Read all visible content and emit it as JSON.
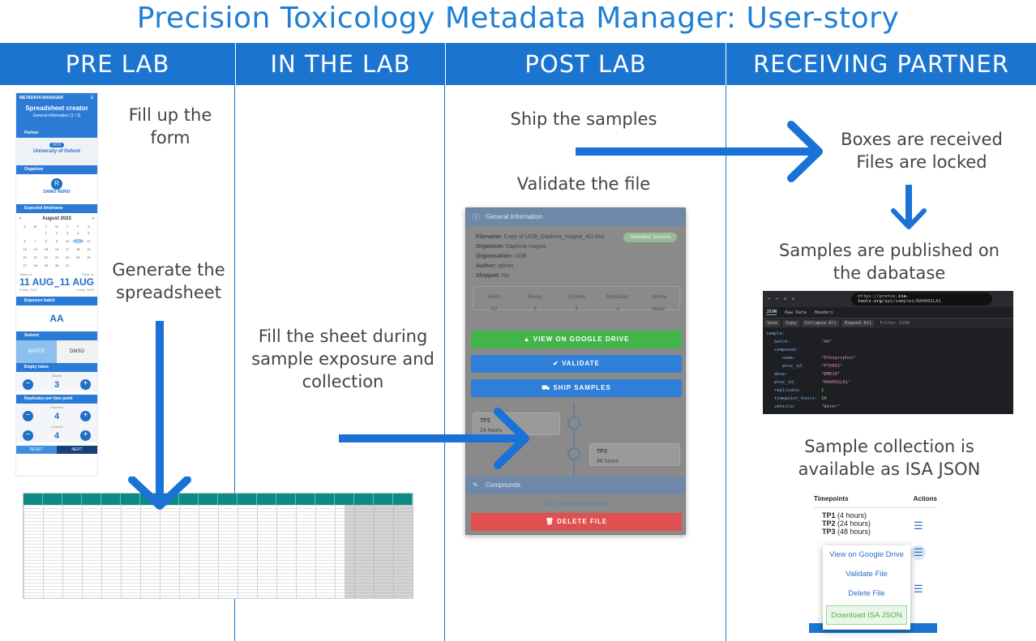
{
  "title": "Precision Toxicology Metadata Manager: User-story",
  "columns": [
    "PRE LAB",
    "IN THE LAB",
    "POST LAB",
    "RECEIVING PARTNER"
  ],
  "steps": {
    "fill_form": "Fill up the\nform",
    "generate": "Generate the\nspreadsheet",
    "fill_sheet": "Fill the sheet during\nsample exposure and\ncollection",
    "ship": "Ship the samples",
    "validate": "Validate the file",
    "received": "Boxes are received\nFiles are locked",
    "published": "Samples are published on\nthe dabatase",
    "isa": "Sample collection is\navailable as ISA JSON"
  },
  "phone": {
    "brand": "METADATA MANAGER",
    "heading": "Spreadsheet creator",
    "subheading": "General Information (1 / 3)",
    "partner_label": "Partner",
    "partner_code": "UOX",
    "partner_name": "University of Oxford",
    "organism_label": "Organism",
    "organism_code": "R",
    "organism_name": "DANIO RERIO",
    "timeframe_label": "Expected timeframe",
    "month": "August 2023",
    "weekdays": [
      "S",
      "M",
      "T",
      "W",
      "T",
      "F",
      "S"
    ],
    "days": [
      "",
      "",
      "1",
      "2",
      "3",
      "4",
      "5",
      "6",
      "7",
      "8",
      "9",
      "10",
      "11",
      "12",
      "13",
      "14",
      "15",
      "16",
      "17",
      "18",
      "19",
      "20",
      "21",
      "22",
      "23",
      "24",
      "25",
      "26",
      "27",
      "28",
      "29",
      "30",
      "31",
      "",
      ""
    ],
    "start_label": "Starts on",
    "start_date": "11 AUG",
    "start_day": "Friday, 2023",
    "end_label": "Ends on",
    "end_date": "11 AUG",
    "end_day": "Friday, 2023",
    "exposure_label": "Exposure batch",
    "exposure_value": "AA",
    "solvent_label": "Solvent",
    "solvent_opt1": "WATER",
    "solvent_opt2": "DMSO",
    "empty_label": "Empty tubes",
    "blanks_label": "Blanks",
    "blanks_value": "3",
    "replicates_label": "Replicates per time point",
    "exposed_label": "Exposed",
    "exposed_value": "4",
    "controls_label": "Controls",
    "controls_value": "4",
    "reset": "RESET",
    "next": "NEXT"
  },
  "validator": {
    "section1": "General Information",
    "filename_label": "Filename:",
    "filename": "Copy of UOB_Daphnia_magna_AD.xlsx",
    "organism_label": "Organism:",
    "organism": "Daphnia magna",
    "organisation_label": "Organisation:",
    "organisation": "UOB",
    "author_label": "Author:",
    "author": "admin",
    "shipped_label": "Shipped:",
    "shipped": "No",
    "badge": "Validated: success",
    "table_headers": [
      "Batch",
      "Blanks",
      "Controls",
      "Replicates",
      "Vehicle"
    ],
    "table_values": [
      "AD",
      "3",
      "4",
      "4",
      "Water"
    ],
    "btn_drive": "VIEW ON GOOGLE DRIVE",
    "btn_validate": "VALIDATE",
    "btn_ship": "SHIP SAMPLES",
    "tp2": "TP2",
    "tp2_hours": "24 hours",
    "tp3": "TP3",
    "tp3_hours": "48 hours",
    "section2": "Compounds",
    "compound": "N,N'-diethylacrylamide",
    "btn_delete": "DELETE FILE"
  },
  "json_viewer": {
    "url_prefix": "https://pretox.",
    "url_domain": "isa-tools.org",
    "url_path": "/api/samples/RAA002LA1",
    "tabs": [
      "JSON",
      "Raw Data",
      "Headers"
    ],
    "tools": [
      "Save",
      "Copy",
      "Collapse All",
      "Expand All",
      "Filter JSON"
    ],
    "lines": [
      {
        "key": "sample:",
        "val": "",
        "indent": 0
      },
      {
        "key": "batch:",
        "val": "\"AA\"",
        "indent": 1
      },
      {
        "key": "compound:",
        "val": "",
        "indent": 1
      },
      {
        "key": "name:",
        "val": "\"Ethoprophos\"",
        "indent": 2
      },
      {
        "key": "ptox_id:",
        "val": "\"PTX002\"",
        "indent": 2
      },
      {
        "key": "dose:",
        "val": "\"BMD10\"",
        "indent": 1
      },
      {
        "key": "ptox_id:",
        "val": "\"RAA002LA1\"",
        "indent": 1
      },
      {
        "key": "replicate:",
        "val": "1",
        "indent": 1
      },
      {
        "key": "timepoint_hours:",
        "val": "10",
        "indent": 1
      },
      {
        "key": "vehicle:",
        "val": "\"Water\"",
        "indent": 1
      }
    ]
  },
  "timepoints": {
    "header": "Timepoints",
    "actions": "Actions",
    "items": [
      {
        "tp": "TP1",
        "hours": "(4 hours)"
      },
      {
        "tp": "TP2",
        "hours": "(24 hours)"
      },
      {
        "tp": "TP3",
        "hours": "(48 hours)"
      }
    ],
    "menu": [
      "View on Google Drive",
      "Validate File",
      "Delete File",
      "Download ISA JSON"
    ]
  },
  "colors": {
    "brand_blue": "#1b75d0",
    "arrow_blue": "#1a72d6",
    "green": "#43b54a",
    "red": "#e05050"
  }
}
